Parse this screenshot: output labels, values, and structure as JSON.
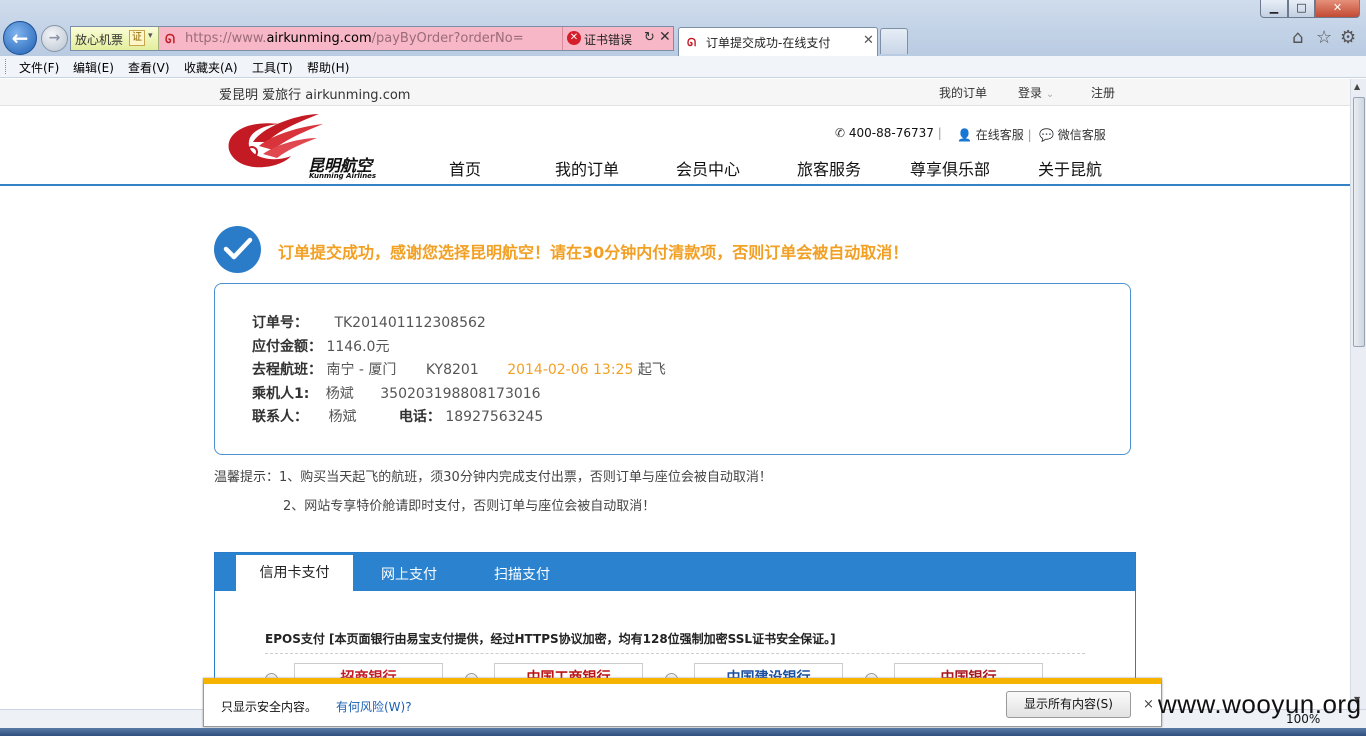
{
  "browser": {
    "fav_label": "放心机票",
    "cert_glyph": "证",
    "url_prefix": "https://www.",
    "url_host": "airkunming.com",
    "url_rest": "/payByOrder?orderNo=",
    "cert_error": "证书错误",
    "tab_title": "订单提交成功-在线支付",
    "menu": [
      "文件(F)",
      "编辑(E)",
      "查看(V)",
      "收藏夹(A)",
      "工具(T)",
      "帮助(H)"
    ]
  },
  "topstrip": {
    "site": "爱昆明 爱旅行 airkunming.com",
    "my_orders": "我的订单",
    "login": "登录",
    "register": "注册"
  },
  "header": {
    "logo_cn": "昆明航空",
    "logo_en": "Kunming Airlines",
    "phone": "400-88-76737",
    "online_service": "在线客服",
    "wechat_service": "微信客服",
    "nav": [
      "首页",
      "我的订单",
      "会员中心",
      "旅客服务",
      "尊享俱乐部",
      "关于昆航"
    ]
  },
  "success_message": "订单提交成功，感谢您选择昆明航空！请在30分钟内付清款项，否则订单会被自动取消！",
  "order": {
    "order_no_label": "订单号：",
    "order_no": "TK201401112308562",
    "amount_label": "应付金额：",
    "amount": "1146.0元",
    "flight_label": "去程航班：",
    "route": "南宁 - 厦门",
    "flight_no": "KY8201",
    "departure_time": "2014-02-06 13:25",
    "depart_suffix": "起飞",
    "passenger_label": "乘机人1:",
    "passenger_name": "杨斌",
    "passenger_id": "350203198808173016",
    "contact_label": "联系人：",
    "contact_name": "杨斌",
    "phone_label": "电话：",
    "phone": "18927563245"
  },
  "tips": {
    "line1": "温馨提示：1、购买当天起飞的航班，须30分钟内完成支付出票，否则订单与座位会被自动取消！",
    "line2": "2、网站专享特价舱请即时支付，否则订单与座位会被自动取消！"
  },
  "payment": {
    "tabs": [
      "信用卡支付",
      "网上支付",
      "扫描支付"
    ],
    "epos_note": "EPOS支付 [本页面银行由易宝支付提供，经过HTTPS协议加密，均有128位强制加密SSL证书安全保证。]",
    "banks": [
      "招商银行",
      "中国工商银行",
      "中国建设银行",
      "中国银行"
    ]
  },
  "infobar": {
    "message": "只显示安全内容。",
    "risk_link": "有何风险(W)?",
    "show_all_button": "显示所有内容(S)",
    "close": "×"
  },
  "status": {
    "zoom": "100%",
    "watermark": "www.wooyun.org"
  },
  "colors": {
    "accent_blue": "#2b83d0",
    "highlight_orange": "#f2a024",
    "brand_red": "#c41a24",
    "infobar_yellow": "#f6b400"
  }
}
